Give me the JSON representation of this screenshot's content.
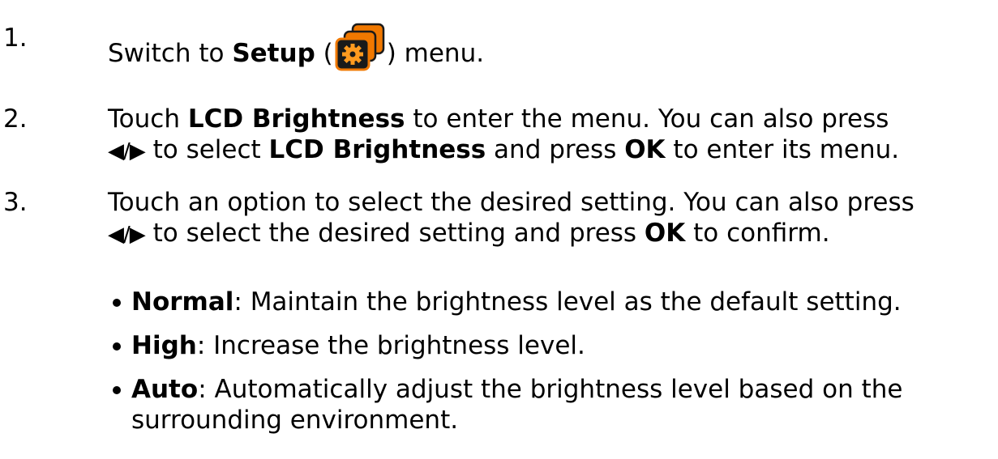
{
  "steps": [
    {
      "number": "1.",
      "prefix": "Switch to ",
      "bold_term": "Setup",
      "open_paren": " (",
      "icon": "setup-gear-icon",
      "close_text": ") menu."
    },
    {
      "number": "2.",
      "line1_a": "Touch ",
      "line1_bold": "LCD Brightness",
      "line1_b": " to enter the menu. You can also press",
      "arrows": "◀/▶",
      "line2_a": " to select ",
      "line2_bold1": "LCD Brightness",
      "line2_b": " and press ",
      "line2_bold2": "OK",
      "line2_c": " to enter its menu."
    },
    {
      "number": "3.",
      "line1": "Touch an option to select the desired setting. You can also press",
      "arrows": "◀/▶",
      "line2_a": " to select the desired setting and press ",
      "line2_bold": "OK",
      "line2_b": " to confirm."
    }
  ],
  "options": [
    {
      "term": "Normal",
      "desc": ": Maintain the brightness level as the default setting."
    },
    {
      "term": "High",
      "desc": ": Increase the brightness level."
    },
    {
      "term": "Auto",
      "desc_line1": ": Automatically adjust the brightness level based on the",
      "desc_line2": "surrounding environment."
    }
  ],
  "colors": {
    "icon_orange": "#f07800",
    "icon_dark": "#1a1a1a",
    "gear": "#ff9a1f"
  }
}
